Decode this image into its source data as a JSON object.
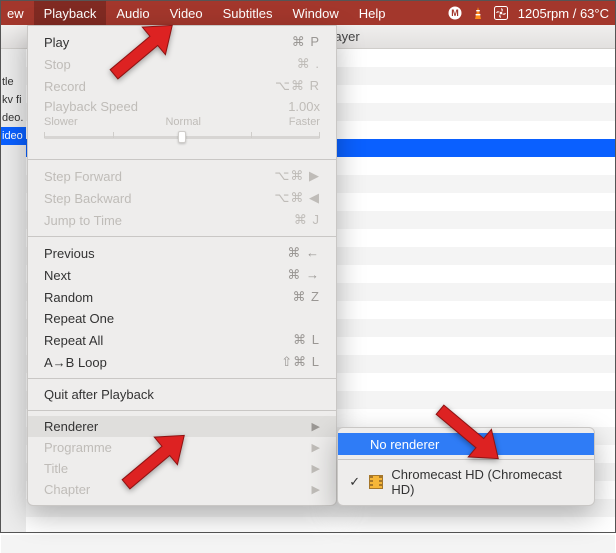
{
  "menubar": {
    "items": [
      {
        "label": "ew",
        "cut": true
      },
      {
        "label": "Playback",
        "selected": true
      },
      {
        "label": "Audio"
      },
      {
        "label": "Video"
      },
      {
        "label": "Subtitles"
      },
      {
        "label": "Window"
      },
      {
        "label": "Help"
      }
    ],
    "status": {
      "fan": "1205rpm / 63°C"
    }
  },
  "window": {
    "title": "VLC media player"
  },
  "sidebar_fragments": [
    "tle",
    "kv fi",
    "deo.",
    "ideo"
  ],
  "playback_menu": {
    "items": [
      {
        "label": "Play",
        "shortcut": "⌘ P",
        "enabled": true
      },
      {
        "label": "Stop",
        "shortcut": "⌘ .",
        "enabled": false
      },
      {
        "label": "Record",
        "shortcut": "⌥⌘ R",
        "enabled": false
      },
      {
        "type": "speed",
        "title": "Playback Speed",
        "value": "1.00x",
        "slower": "Slower",
        "normal": "Normal",
        "faster": "Faster",
        "enabled": false
      },
      {
        "type": "sep"
      },
      {
        "label": "Step Forward",
        "shortcut": "⌥⌘ ▶",
        "enabled": false
      },
      {
        "label": "Step Backward",
        "shortcut": "⌥⌘ ◀",
        "enabled": false
      },
      {
        "label": "Jump to Time",
        "shortcut": "⌘ J",
        "enabled": false
      },
      {
        "type": "sep"
      },
      {
        "label": "Previous",
        "shortcut": "⌘ ←",
        "enabled": true
      },
      {
        "label": "Next",
        "shortcut": "⌘ →",
        "enabled": true
      },
      {
        "label": "Random",
        "shortcut": "⌘ Z",
        "enabled": true
      },
      {
        "label": "Repeat One",
        "shortcut": "",
        "enabled": true
      },
      {
        "label": "Repeat All",
        "shortcut": "⌘ L",
        "enabled": true
      },
      {
        "label": "A→B Loop",
        "shortcut": "⇧⌘ L",
        "enabled": true
      },
      {
        "type": "sep"
      },
      {
        "label": "Quit after Playback",
        "shortcut": "",
        "enabled": true
      },
      {
        "type": "sep"
      },
      {
        "label": "Renderer",
        "submenu": true,
        "enabled": true,
        "hover": true
      },
      {
        "label": "Programme",
        "submenu": true,
        "enabled": false
      },
      {
        "label": "Title",
        "submenu": true,
        "enabled": false
      },
      {
        "label": "Chapter",
        "submenu": true,
        "enabled": false
      }
    ]
  },
  "renderer_submenu": {
    "items": [
      {
        "label": "No renderer",
        "selected": true,
        "checked": false,
        "icon": null
      },
      {
        "type": "sep"
      },
      {
        "label": "Chromecast HD (Chromecast HD)",
        "selected": false,
        "checked": true,
        "icon": "film"
      }
    ]
  }
}
